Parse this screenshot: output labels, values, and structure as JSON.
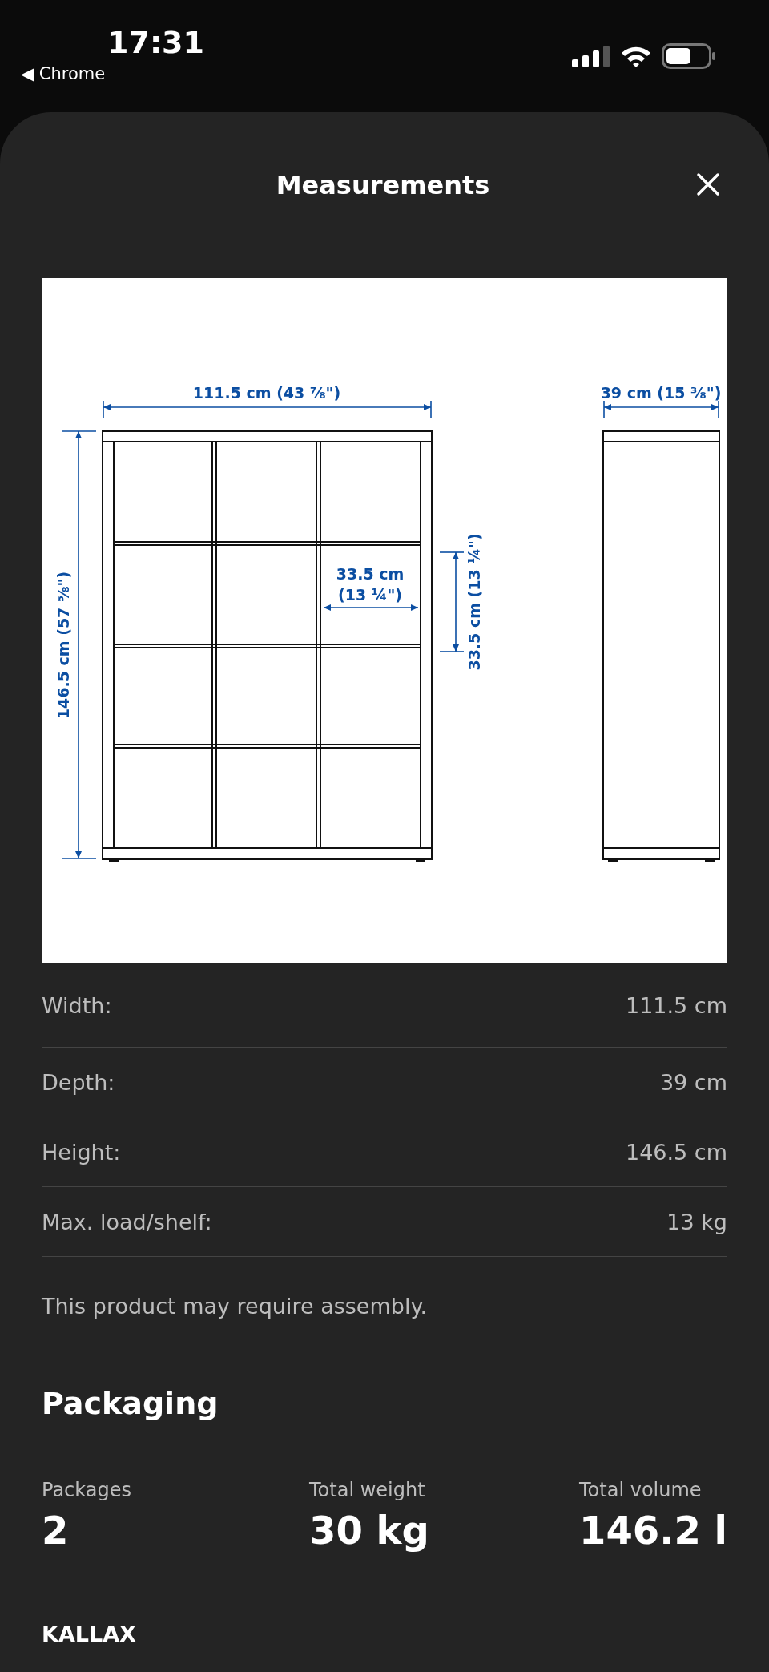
{
  "status_bar": {
    "time": "17:31",
    "back_glyph": "◀",
    "back_app": "Chrome"
  },
  "sheet": {
    "title": "Measurements",
    "diagram": {
      "labels": [
        {
          "kind": "overall_width",
          "lines": [
            "111.5 cm (43 ⅞\")"
          ]
        },
        {
          "kind": "depth",
          "lines": [
            "39 cm (15 ⅜\")"
          ]
        },
        {
          "kind": "overall_height",
          "lines": [
            "146.5 cm (57 ⅝\")"
          ]
        },
        {
          "kind": "cell_width",
          "lines": [
            "33.5 cm",
            "(13 ¼\")"
          ]
        },
        {
          "kind": "cell_height",
          "lines": [
            "33.5 cm (13 ¼\")"
          ]
        }
      ]
    },
    "specs": [
      {
        "label": "Width:",
        "value": "111.5 cm"
      },
      {
        "label": "Depth:",
        "value": "39 cm"
      },
      {
        "label": "Height:",
        "value": "146.5 cm"
      },
      {
        "label": "Max. load/shelf:",
        "value": "13 kg"
      }
    ],
    "note": "This product may require assembly.",
    "packaging": {
      "heading": "Packaging",
      "stats": [
        {
          "label": "Packages",
          "value": "2"
        },
        {
          "label": "Total weight",
          "value": "30 kg"
        },
        {
          "label": "Total volume",
          "value": "146.2 l"
        }
      ]
    },
    "product_name": "KALLAX"
  }
}
